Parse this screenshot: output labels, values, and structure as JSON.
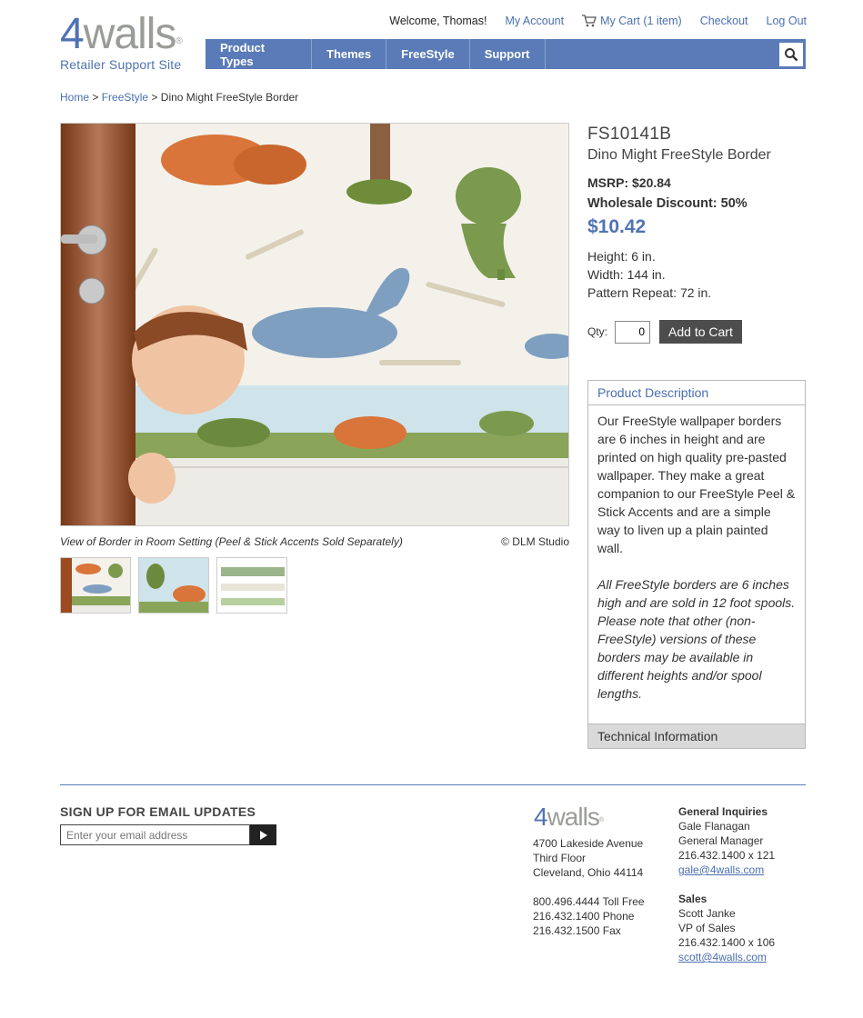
{
  "brand": {
    "number": "4",
    "word": "walls",
    "reg": "®",
    "subtitle": "Retailer Support Site"
  },
  "top_links": {
    "welcome": "Welcome, Thomas!",
    "my_account": "My Account",
    "my_cart": "My Cart (1 item)",
    "checkout": "Checkout",
    "log_out": "Log Out"
  },
  "nav": [
    "Product Types",
    "Themes",
    "FreeStyle",
    "Support"
  ],
  "breadcrumb": {
    "home": "Home",
    "section": "FreeStyle",
    "current": "Dino Might FreeStyle Border",
    "sep": ">"
  },
  "image": {
    "caption": "View of Border in Room Setting (Peel & Stick Accents Sold Separately)",
    "credit": "© DLM Studio"
  },
  "product": {
    "sku": "FS10141B",
    "name": "Dino Might FreeStyle Border",
    "msrp_label": "MSRP:",
    "msrp": "$20.84",
    "discount_label": "Wholesale Discount:",
    "discount": "50%",
    "price": "$10.42",
    "height": "Height: 6 in.",
    "width": "Width: 144 in.",
    "repeat": "Pattern Repeat: 72 in.",
    "qty_label": "Qty:",
    "qty_value": "0",
    "add_to_cart": "Add to Cart"
  },
  "description": {
    "heading": "Product Description",
    "para1": "Our FreeStyle wallpaper borders are 6 inches in height and are printed on high quality pre-pasted wallpaper. They make a great companion to our FreeStyle Peel & Stick Accents and are a simple way to liven up a plain painted wall.",
    "para2": "All FreeStyle borders are 6 inches high and are sold in 12 foot spools. Please note that other (non-FreeStyle) versions of these borders may be available in different heights and/or spool lengths.",
    "tech_heading": "Technical Information"
  },
  "footer": {
    "signup_title": "SIGN UP FOR EMAIL UPDATES",
    "email_placeholder": "Enter your email address",
    "address": [
      "4700 Lakeside Avenue",
      "Third Floor",
      "Cleveland, Ohio 44114"
    ],
    "phones": [
      "800.496.4444 Toll Free",
      "216.432.1400 Phone",
      "216.432.1500 Fax"
    ],
    "general": {
      "title": "General Inquiries",
      "name": "Gale Flanagan",
      "role": "General Manager",
      "phone": "216.432.1400 x 121",
      "email": "gale@4walls.com"
    },
    "sales": {
      "title": "Sales",
      "name": "Scott Janke",
      "role": "VP of Sales",
      "phone": "216.432.1400 x 106",
      "email": "scott@4walls.com"
    }
  },
  "colors": {
    "brand_blue": "#4f73b3",
    "nav_bg": "#5a7bb8",
    "button_dark": "#4d4d4d",
    "brand_grey": "#9a9c98"
  },
  "icons": {
    "cart": "cart-icon",
    "search": "search-icon",
    "submit": "arrow-right-icon"
  }
}
